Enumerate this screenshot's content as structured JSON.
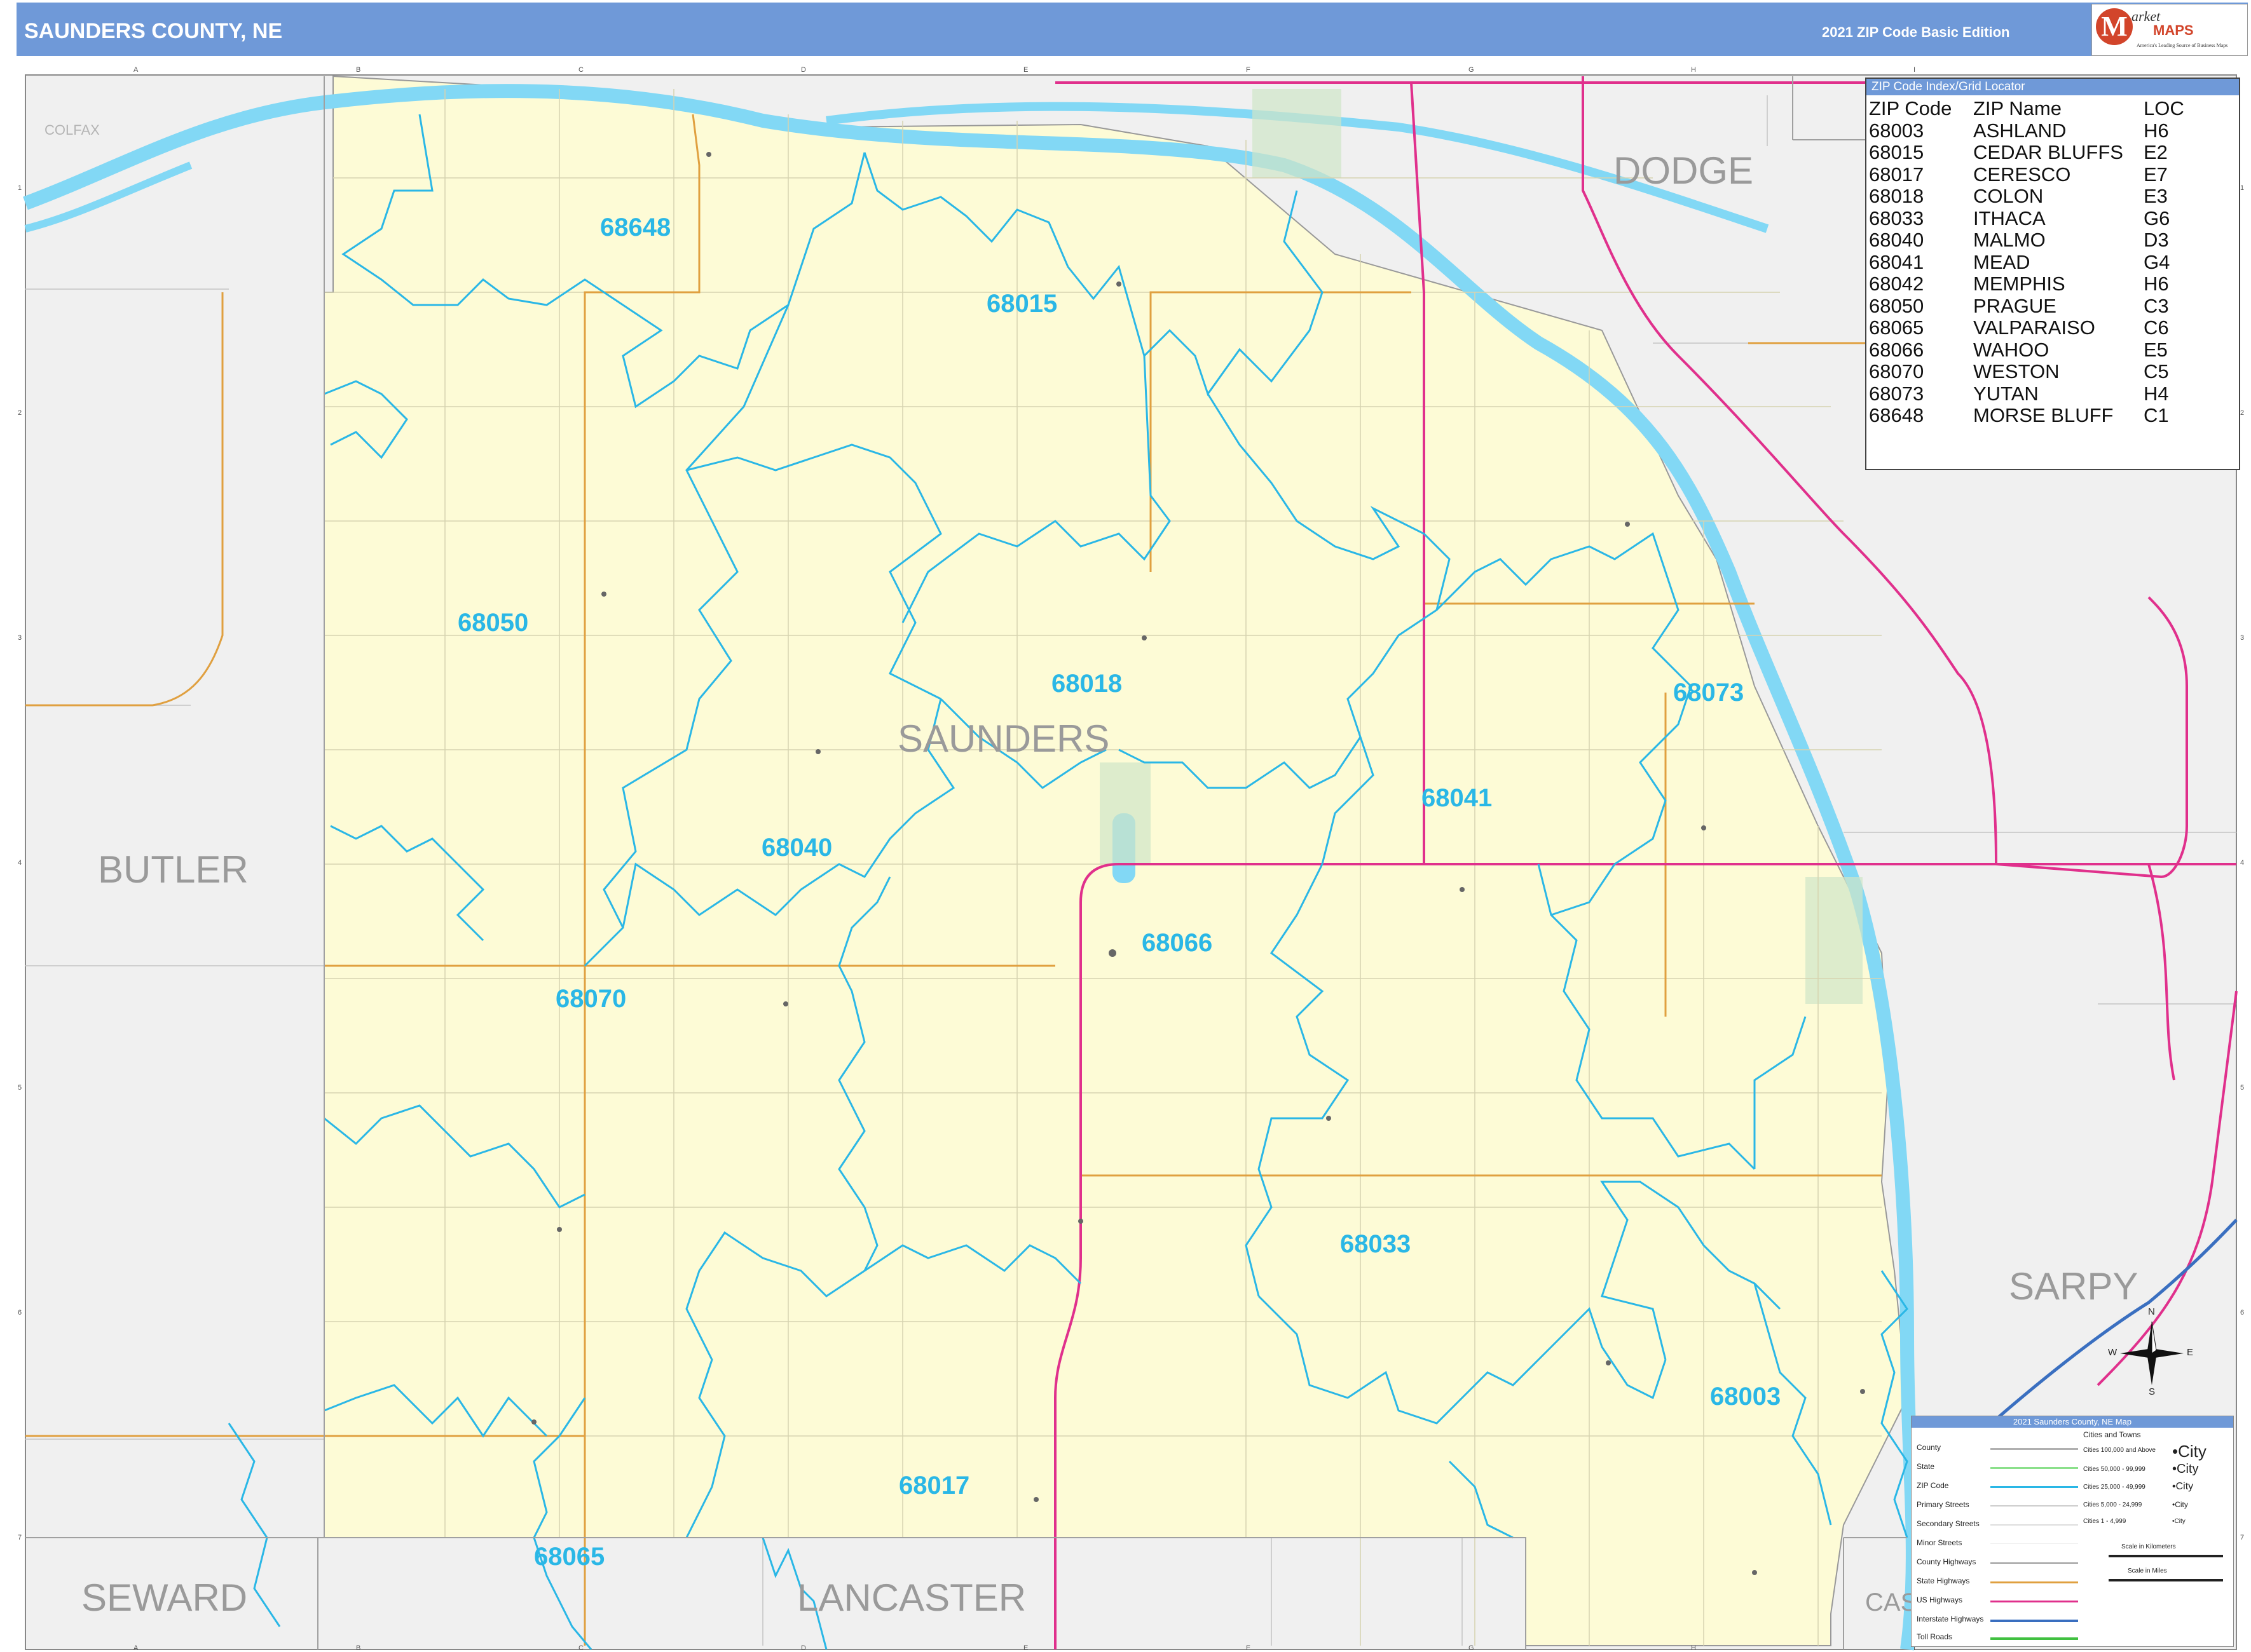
{
  "header": {
    "title": "SAUNDERS COUNTY, NE",
    "edition": "2021 ZIP Code Basic Edition",
    "logo": {
      "mark": "M",
      "word1": "arket",
      "word2": "MAPS",
      "tagline": "America's Leading Source of Business Maps"
    }
  },
  "counties": {
    "main": "SAUNDERS",
    "dodge": "DODGE",
    "butler": "BUTLER",
    "seward": "SEWARD",
    "lancaster": "LANCASTER",
    "sarpy": "SARPY",
    "cass": "CAS"
  },
  "towns": {
    "colfax": "COLFAX"
  },
  "zips": {
    "z68648": "68648",
    "z68015": "68015",
    "z68050": "68050",
    "z68018": "68018",
    "z68073": "68073",
    "z68041": "68041",
    "z68040": "68040",
    "z68066": "68066",
    "z68070": "68070",
    "z68033": "68033",
    "z68003": "68003",
    "z68017": "68017",
    "z68065": "68065"
  },
  "grid": {
    "letters": [
      "A",
      "B",
      "C",
      "D",
      "E",
      "F",
      "G",
      "H",
      "I"
    ],
    "numbers": [
      "1",
      "2",
      "3",
      "4",
      "5",
      "6",
      "7"
    ]
  },
  "zip_index": {
    "title": "ZIP Code Index/Grid Locator",
    "headers": {
      "zip": "ZIP Code",
      "name": "ZIP Name",
      "loc": "LOC"
    },
    "rows": [
      {
        "zip": "68003",
        "name": "ASHLAND",
        "loc": "H6"
      },
      {
        "zip": "68015",
        "name": "CEDAR BLUFFS",
        "loc": "E2"
      },
      {
        "zip": "68017",
        "name": "CERESCO",
        "loc": "E7"
      },
      {
        "zip": "68018",
        "name": "COLON",
        "loc": "E3"
      },
      {
        "zip": "68033",
        "name": "ITHACA",
        "loc": "G6"
      },
      {
        "zip": "68040",
        "name": "MALMO",
        "loc": "D3"
      },
      {
        "zip": "68041",
        "name": "MEAD",
        "loc": "G4"
      },
      {
        "zip": "68042",
        "name": "MEMPHIS",
        "loc": "H6"
      },
      {
        "zip": "68050",
        "name": "PRAGUE",
        "loc": "C3"
      },
      {
        "zip": "68065",
        "name": "VALPARAISO",
        "loc": "C6"
      },
      {
        "zip": "68066",
        "name": "WAHOO",
        "loc": "E5"
      },
      {
        "zip": "68070",
        "name": "WESTON",
        "loc": "C5"
      },
      {
        "zip": "68073",
        "name": "YUTAN",
        "loc": "H4"
      },
      {
        "zip": "68648",
        "name": "MORSE BLUFF",
        "loc": "C1"
      }
    ]
  },
  "legend": {
    "title": "2021 Saunders County, NE Map",
    "rows": [
      {
        "label": "County",
        "color": "#b0b0b0"
      },
      {
        "label": "State",
        "color": "#8be08b"
      },
      {
        "label": "ZIP Code",
        "color": "#2ab7e6"
      },
      {
        "label": "Primary Streets",
        "color": "#cccccc"
      },
      {
        "label": "Secondary Streets",
        "color": "#dddddd"
      },
      {
        "label": "Minor Streets",
        "color": "#eeeeee"
      },
      {
        "label": "County Highways",
        "color": "#999999"
      },
      {
        "label": "State Highways",
        "color": "#e0a040"
      },
      {
        "label": "US Highways",
        "color": "#e0308c"
      },
      {
        "label": "Interstate Highways",
        "color": "#3a6fc0"
      },
      {
        "label": "Toll Roads",
        "color": "#40c040"
      }
    ],
    "cities_title": "Cities and Towns",
    "cities": [
      {
        "label": "Cities 100,000 and Above",
        "sample": "•City"
      },
      {
        "label": "Cities 50,000 - 99,999",
        "sample": "•City"
      },
      {
        "label": "Cities 25,000 - 49,999",
        "sample": "•City"
      },
      {
        "label": "Cities 5,000 - 24,999",
        "sample": "•City"
      },
      {
        "label": "Cities 1 - 4,999",
        "sample": "•City"
      }
    ],
    "scale_km": "Scale in Kilometers",
    "scale_mi": "Scale in Miles"
  },
  "compass": {
    "n": "N",
    "s": "S",
    "e": "E",
    "w": "W"
  },
  "colors": {
    "header": "#6f99d8",
    "county_fill": "#fdfbd6",
    "outside_fill": "#f0f0f0",
    "water": "#82d8f5",
    "zip_line": "#2ab7e6",
    "us_highway": "#e0308c",
    "state_highway": "#e0a040"
  }
}
